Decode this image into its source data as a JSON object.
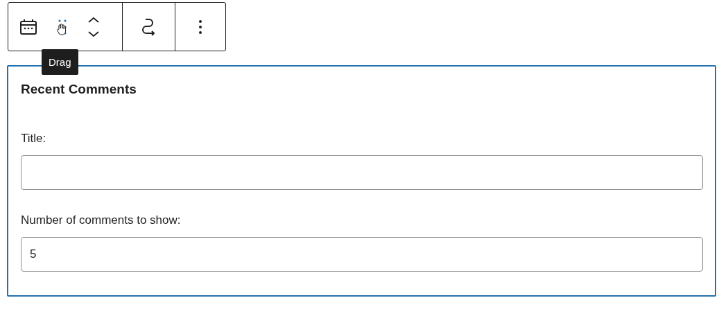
{
  "toolbar": {
    "tooltip": "Drag"
  },
  "widget": {
    "heading": "Recent Comments",
    "fields": [
      {
        "label": "Title:"
      },
      {
        "label": "Number of comments to show:",
        "value": "5"
      }
    ]
  }
}
